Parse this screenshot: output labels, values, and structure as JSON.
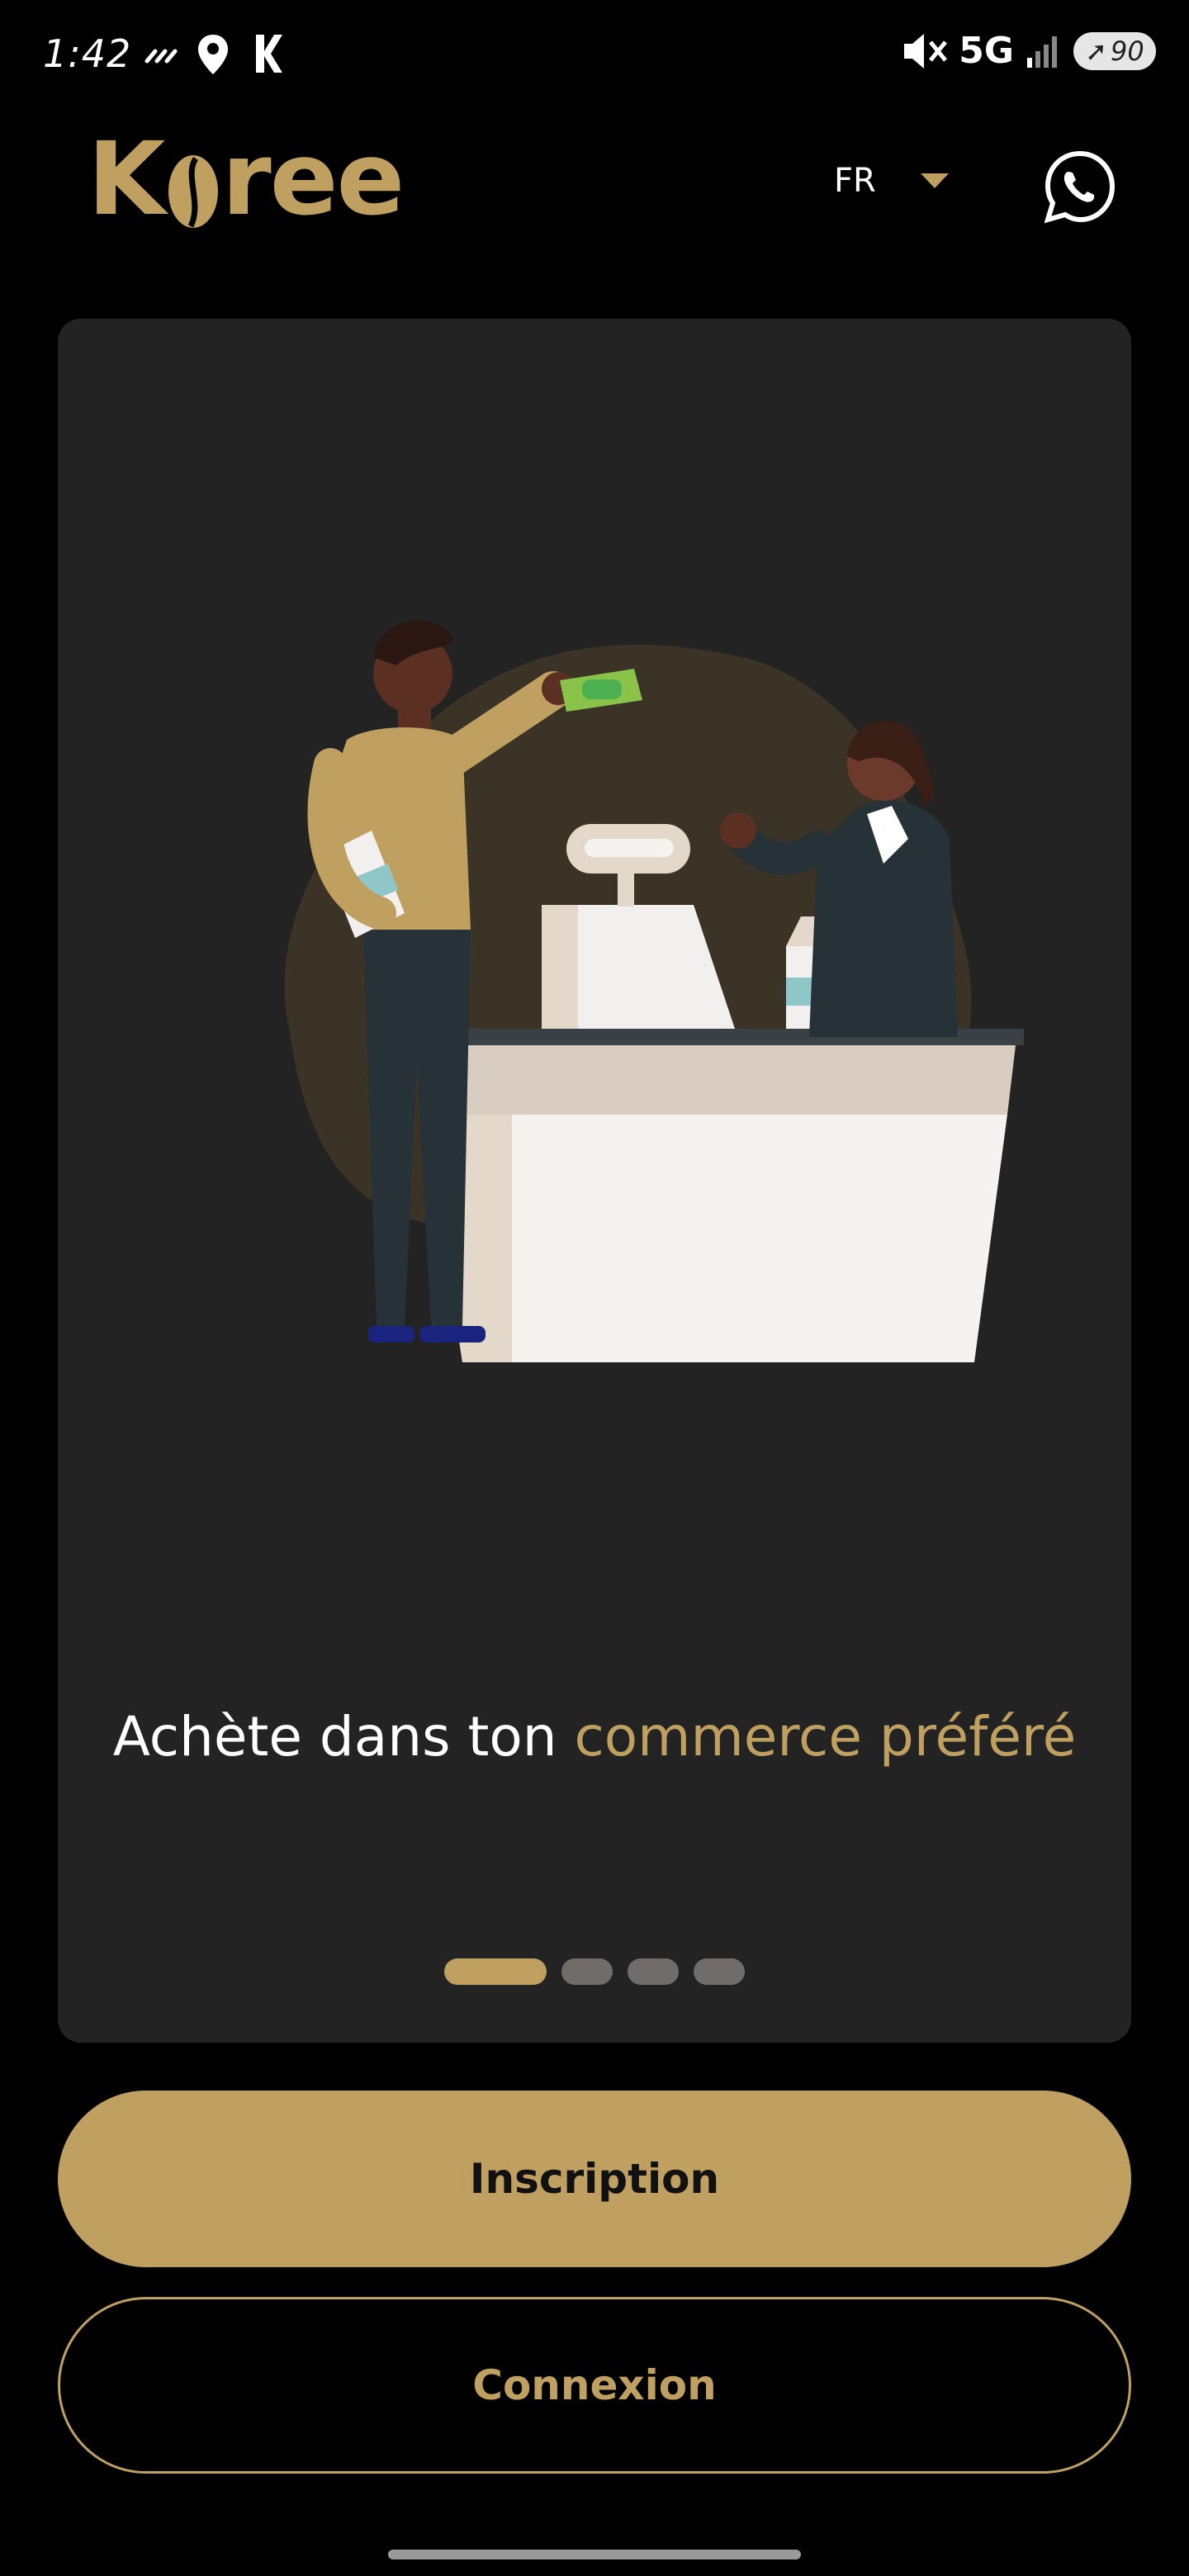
{
  "status_bar": {
    "time": "1:42",
    "network": "5G",
    "battery": "90"
  },
  "header": {
    "logo_text": "Koree",
    "logo_prefix": "K",
    "logo_suffix": "ree",
    "language": "FR"
  },
  "onboarding": {
    "headline_plain": "Achète dans ton ",
    "headline_accent": "commerce préféré",
    "page_count": 4,
    "active_page": 1
  },
  "buttons": {
    "signup_label": "Inscription",
    "login_label": "Connexion"
  },
  "colors": {
    "accent": "#c0a060",
    "background": "#000000",
    "card": "#232323",
    "dot_inactive": "#6f6c6a"
  },
  "icons": {
    "language_dropdown": "chevron-down-icon",
    "whatsapp": "whatsapp-icon"
  }
}
